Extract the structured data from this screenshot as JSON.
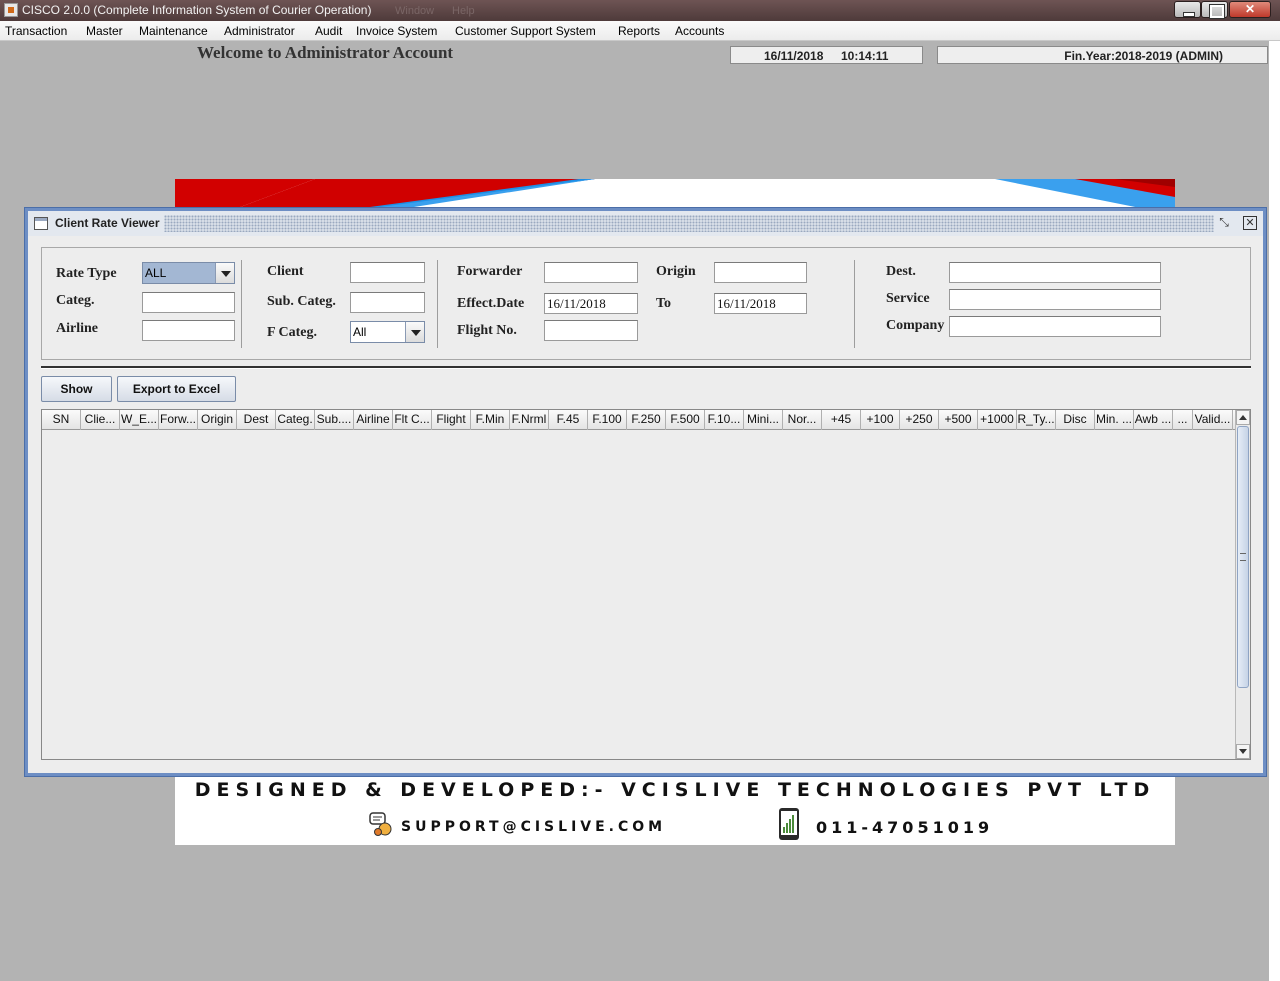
{
  "window": {
    "title": "CISCO 2.0.0 (Complete Information System of Courier Operation)",
    "ghost_menu": [
      "Window",
      "Help"
    ]
  },
  "menu": [
    "Transaction",
    "Master",
    "Maintenance",
    "Administrator",
    "Audit",
    "Invoice System",
    "Customer Support System",
    "Reports",
    "Accounts"
  ],
  "welcome": "Welcome to Administrator Account",
  "status": {
    "date": "16/11/2018",
    "time": "10:14:11",
    "fin_year": "Fin.Year:2018-2019  (ADMIN)"
  },
  "banner": {
    "designed_by": "DESIGNED & DEVELOPED:- VCISLIVE TECHNOLOGIES PVT LTD",
    "email": "SUPPORT@CISLIVE.COM",
    "phone": "011-47051019"
  },
  "frame": {
    "title": "Client Rate Viewer"
  },
  "filters": {
    "rate_type_label": "Rate Type",
    "rate_type_value": "ALL",
    "categ_label": "Categ.",
    "categ_value": "",
    "airline_label": "Airline",
    "airline_value": "",
    "client_label": "Client",
    "client_value": "",
    "sub_categ_label": "Sub. Categ.",
    "sub_categ_value": "",
    "f_categ_label": "F Categ.",
    "f_categ_value": "All",
    "forwarder_label": "Forwarder",
    "forwarder_value": "",
    "effect_date_label": "Effect.Date",
    "effect_date_value": "16/11/2018",
    "flight_no_label": "Flight No.",
    "flight_no_value": "",
    "origin_label": "Origin",
    "origin_value": "",
    "to_label": "To",
    "to_value": "16/11/2018",
    "dest_label": "Dest.",
    "dest_value": "",
    "service_label": "Service",
    "service_value": "",
    "company_label": "Company",
    "company_value": ""
  },
  "buttons": {
    "show": "Show",
    "export": "Export to Excel"
  },
  "table": {
    "columns": [
      "SN",
      "Clie...",
      "W_E...",
      "Forw...",
      "Origin",
      "Dest",
      "Categ.",
      "Sub....",
      "Airline",
      "Flt C...",
      "Flight",
      "F.Min",
      "F.Nrml",
      "F.45",
      "F.100",
      "F.250",
      "F.500",
      "F.10...",
      "Mini...",
      "Nor...",
      "+45",
      "+100",
      "+250",
      "+500",
      "+1000",
      "R_Ty...",
      "Disc",
      "Min. ...",
      "Awb ...",
      "...",
      "Valid..."
    ],
    "rows": []
  },
  "colors": {
    "frame_border": "#6d8ec4",
    "desktop": "#b3b3b3",
    "titlebar": "#5a4444",
    "combo_selected": "#a3b7d3"
  }
}
